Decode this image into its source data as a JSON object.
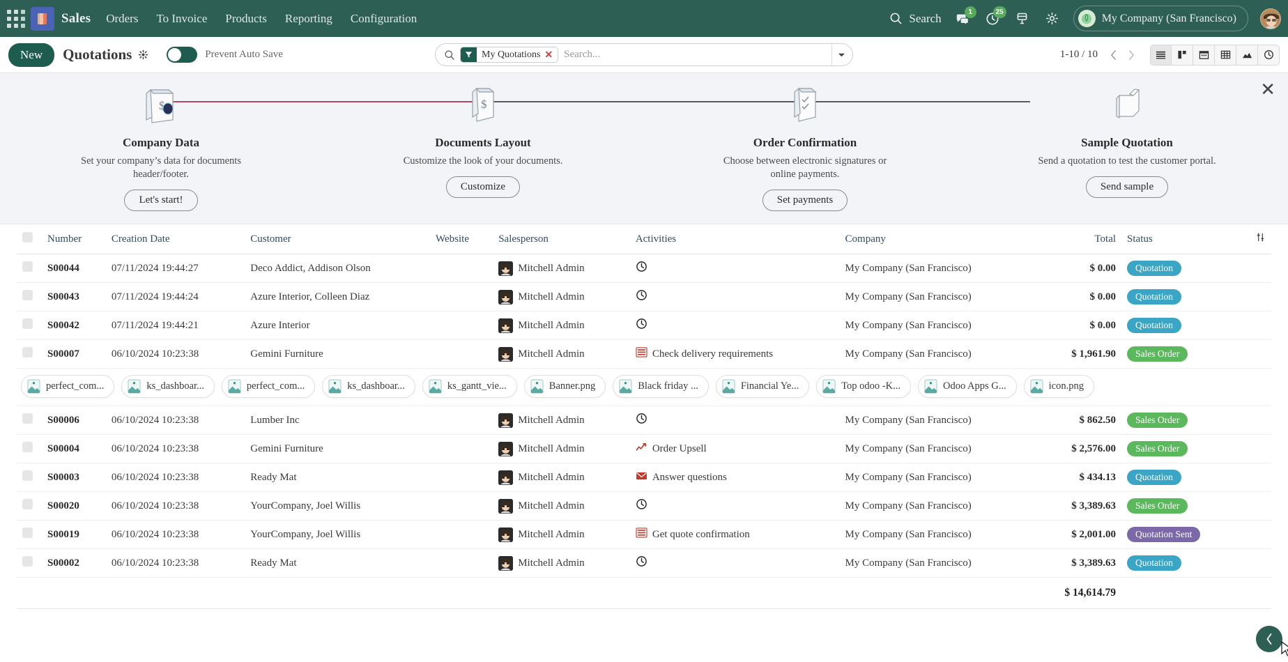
{
  "navbar": {
    "apps_icon": "apps-grid-icon",
    "app_logo_icon": "sales-app-icon",
    "brand": "Sales",
    "menu": [
      {
        "label": "Orders"
      },
      {
        "label": "To Invoice"
      },
      {
        "label": "Products"
      },
      {
        "label": "Reporting"
      },
      {
        "label": "Configuration"
      }
    ],
    "search_label": "Search",
    "messages_badge": "1",
    "activities_badge": "25",
    "company": "My Company (San Francisco)"
  },
  "controlpanel": {
    "new_label": "New",
    "title": "Quotations",
    "toggle_label": "Prevent Auto Save",
    "toggle_state": "off",
    "search": {
      "facet_label": "My Quotations",
      "placeholder": "Search..."
    },
    "pager": "1-10 / 10",
    "views": [
      {
        "name": "list"
      },
      {
        "name": "kanban"
      },
      {
        "name": "calendar"
      },
      {
        "name": "pivot"
      },
      {
        "name": "graph"
      },
      {
        "name": "activity"
      }
    ]
  },
  "onboarding": {
    "close_label": "✕",
    "steps": [
      {
        "title": "Company Data",
        "desc": "Set your company’s data for documents header/footer.",
        "button": "Let's start!",
        "icon": "company-data-icon"
      },
      {
        "title": "Documents Layout",
        "desc": "Customize the look of your documents.",
        "button": "Customize",
        "icon": "documents-layout-icon"
      },
      {
        "title": "Order Confirmation",
        "desc": "Choose between electronic signatures or online payments.",
        "button": "Set payments",
        "icon": "order-confirmation-icon"
      },
      {
        "title": "Sample Quotation",
        "desc": "Send a quotation to test the customer portal.",
        "button": "Send sample",
        "icon": "sample-quotation-icon"
      }
    ]
  },
  "table": {
    "columns": [
      "Number",
      "Creation Date",
      "Customer",
      "Website",
      "Salesperson",
      "Activities",
      "Company",
      "Total",
      "Status"
    ],
    "rows": [
      {
        "number": "S00044",
        "date": "07/11/2024 19:44:27",
        "customer": "Deco Addict, Addison Olson",
        "website": "",
        "salesperson": "Mitchell Admin",
        "activity": "",
        "activity_icon": "clock-icon",
        "company": "My Company (San Francisco)",
        "total": "$ 0.00",
        "status": "Quotation",
        "status_kind": "quotation"
      },
      {
        "number": "S00043",
        "date": "07/11/2024 19:44:24",
        "customer": "Azure Interior, Colleen Diaz",
        "website": "",
        "salesperson": "Mitchell Admin",
        "activity": "",
        "activity_icon": "clock-icon",
        "company": "My Company (San Francisco)",
        "total": "$ 0.00",
        "status": "Quotation",
        "status_kind": "quotation"
      },
      {
        "number": "S00042",
        "date": "07/11/2024 19:44:21",
        "customer": "Azure Interior",
        "website": "",
        "salesperson": "Mitchell Admin",
        "activity": "",
        "activity_icon": "clock-icon",
        "company": "My Company (San Francisco)",
        "total": "$ 0.00",
        "status": "Quotation",
        "status_kind": "quotation"
      },
      {
        "number": "S00007",
        "date": "06/10/2024 10:23:38",
        "customer": "Gemini Furniture",
        "website": "",
        "salesperson": "Mitchell Admin",
        "activity": "Check delivery requirements",
        "activity_icon": "list-red-icon",
        "company": "My Company (San Francisco)",
        "total": "$ 1,961.90",
        "status": "Sales Order",
        "status_kind": "sales"
      },
      {
        "number": "S00006",
        "date": "06/10/2024 10:23:38",
        "customer": "Lumber Inc",
        "website": "",
        "salesperson": "Mitchell Admin",
        "activity": "",
        "activity_icon": "clock-icon",
        "company": "My Company (San Francisco)",
        "total": "$ 862.50",
        "status": "Sales Order",
        "status_kind": "sales"
      },
      {
        "number": "S00004",
        "date": "06/10/2024 10:23:38",
        "customer": "Gemini Furniture",
        "website": "",
        "salesperson": "Mitchell Admin",
        "activity": "Order Upsell",
        "activity_icon": "chart-up-red-icon",
        "company": "My Company (San Francisco)",
        "total": "$ 2,576.00",
        "status": "Sales Order",
        "status_kind": "sales"
      },
      {
        "number": "S00003",
        "date": "06/10/2024 10:23:38",
        "customer": "Ready Mat",
        "website": "",
        "salesperson": "Mitchell Admin",
        "activity": "Answer questions",
        "activity_icon": "envelope-red-icon",
        "company": "My Company (San Francisco)",
        "total": "$ 434.13",
        "status": "Quotation",
        "status_kind": "quotation"
      },
      {
        "number": "S00020",
        "date": "06/10/2024 10:23:38",
        "customer": "YourCompany, Joel Willis",
        "website": "",
        "salesperson": "Mitchell Admin",
        "activity": "",
        "activity_icon": "clock-icon",
        "company": "My Company (San Francisco)",
        "total": "$ 3,389.63",
        "status": "Sales Order",
        "status_kind": "sales"
      },
      {
        "number": "S00019",
        "date": "06/10/2024 10:23:38",
        "customer": "YourCompany, Joel Willis",
        "website": "",
        "salesperson": "Mitchell Admin",
        "activity": "Get quote confirmation",
        "activity_icon": "list-red-icon",
        "company": "My Company (San Francisco)",
        "total": "$ 2,001.00",
        "status": "Quotation Sent",
        "status_kind": "sent"
      },
      {
        "number": "S00002",
        "date": "06/10/2024 10:23:38",
        "customer": "Ready Mat",
        "website": "",
        "salesperson": "Mitchell Admin",
        "activity": "",
        "activity_icon": "clock-icon",
        "company": "My Company (San Francisco)",
        "total": "$ 3,389.63",
        "status": "Quotation",
        "status_kind": "quotation"
      }
    ],
    "attachments_after_row": 3,
    "attachments": [
      {
        "label": "perfect_com..."
      },
      {
        "label": "ks_dashboar..."
      },
      {
        "label": "perfect_com..."
      },
      {
        "label": "ks_dashboar..."
      },
      {
        "label": "ks_gantt_vie..."
      },
      {
        "label": "Banner.png"
      },
      {
        "label": "Black friday ..."
      },
      {
        "label": "Financial Ye..."
      },
      {
        "label": "Top odoo -K..."
      },
      {
        "label": "Odoo Apps G..."
      },
      {
        "label": "icon.png"
      }
    ],
    "footer_total": "$ 14,614.79"
  },
  "colors": {
    "brand_green": "#2d5f54",
    "new_button": "#1d5c4e",
    "status_quotation": "#3aa5c4",
    "status_sales_order": "#5cb85c",
    "status_quotation_sent": "#7b68a8",
    "onboarding_done_line": "#b04a5f",
    "onboarding_todo_line": "#5a5a5a",
    "badge_green": "#5ba95c"
  }
}
